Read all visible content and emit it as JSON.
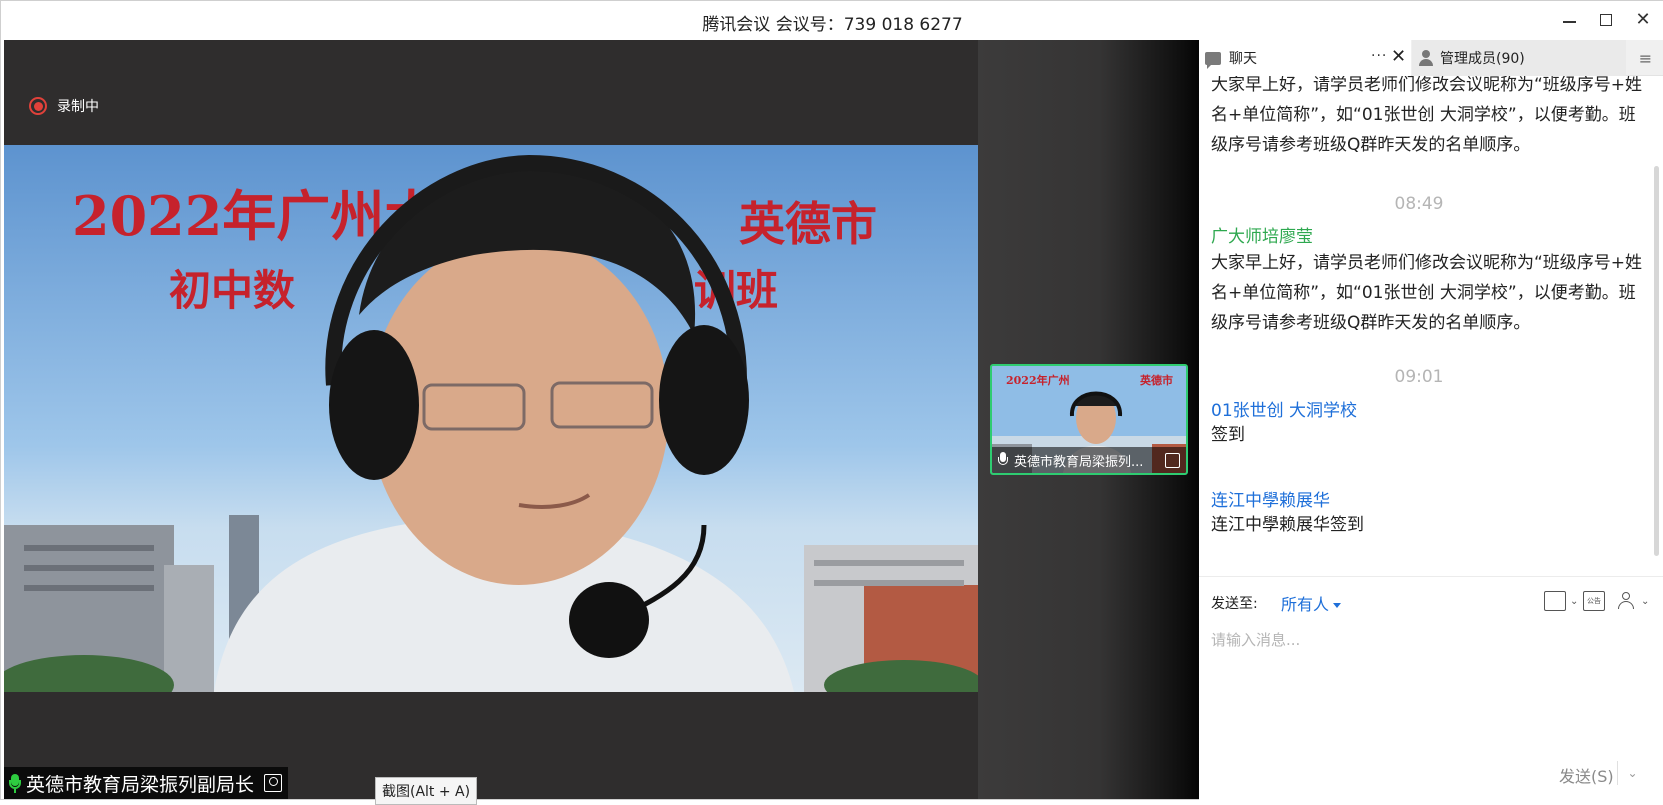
{
  "window": {
    "title": "腾讯会议 会议号：739 018 6277"
  },
  "recording": {
    "label": "录制中"
  },
  "main_video": {
    "speaker_name": "英德市教育局梁振列副局长",
    "banner_line1": "2022年广州大",
    "banner_line1b": "英德市",
    "banner_line2": "初中数",
    "banner_line2b": "训班",
    "banner_year": "202"
  },
  "tooltip": {
    "text": "截图(Alt + A)"
  },
  "thumbnail": {
    "name": "英德市教育局梁振列..."
  },
  "panel": {
    "tabs": {
      "chat": "聊天",
      "members": "管理成员(90)",
      "more": "···",
      "close": "✕",
      "menu": "≡"
    },
    "messages": [
      {
        "text": "大家早上好，请学员老师们修改会议昵称为“班级序号+姓名+单位简称”，如“01张世创 大洞学校”，以便考勤。班级序号请参考班级Q群昨天发的名单顺序。"
      },
      {
        "time": "08:49"
      },
      {
        "sender": "广大师培廖莹",
        "text": "大家早上好，请学员老师们修改会议昵称为“班级序号+姓名+单位简称”，如“01张世创 大洞学校”，以便考勤。班级序号请参考班级Q群昨天发的名单顺序。"
      },
      {
        "time": "09:01"
      },
      {
        "sender": "01张世创  大洞学校",
        "text": "签到"
      },
      {
        "sender": "连江中學赖展华",
        "text": "连江中學赖展华签到"
      }
    ],
    "composer": {
      "send_to_label": "发送至:",
      "send_to_target": "所有人",
      "placeholder": "请输入消息...",
      "send_label": "发送(S)",
      "bulletin_label": "公告"
    }
  },
  "colors": {
    "recording": "#e0413a",
    "sender_host": "#2ea84f",
    "sender_member": "#1e6fd9",
    "active_border": "#2ecc71"
  }
}
